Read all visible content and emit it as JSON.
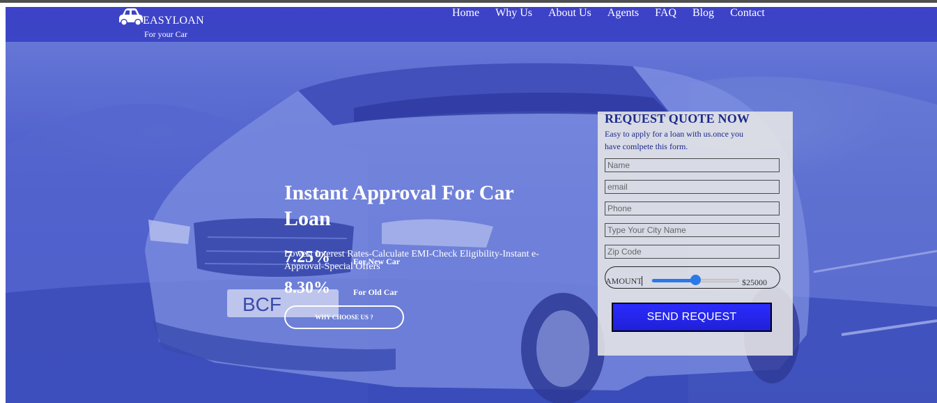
{
  "header": {
    "brand": "EASYLOAN",
    "tagline": "For your Car",
    "logo_icon": "car-icon",
    "nav": [
      "Home",
      "Why Us",
      "About Us",
      "Agents",
      "FAQ",
      "Blog",
      "Contact"
    ]
  },
  "hero": {
    "title": "Instant Approval For Car Loan",
    "subtitle": "Lowest Interest Rates-Calculate EMI-Check Eligibility-Instant e-Approval-Special Offers",
    "rates": [
      {
        "value": "7.25%",
        "label": "For New Car"
      },
      {
        "value": "8.30%",
        "label": "For Old Car"
      }
    ],
    "cta_label": "WHY CHOOSE US ?"
  },
  "quote_form": {
    "title": "REQUEST QUOTE NOW",
    "description": "Easy to apply for a loan with us.once you have comlpete this form.",
    "fields": {
      "name_placeholder": "Name",
      "email_placeholder": "email",
      "phone_placeholder": "Phone",
      "city_placeholder": "Type Your City Name",
      "zip_placeholder": "Zip Code"
    },
    "amount": {
      "label": "AMOUNT",
      "value_text": "$25000",
      "slider_fraction": 0.5
    },
    "submit_label": "SEND REQUEST"
  },
  "colors": {
    "header_bg": "#3d42c7",
    "hero_tint": "#4757c9",
    "panel_title": "#1b2a8a",
    "send_button": "#2b2bff",
    "slider": "#2b79e6"
  }
}
